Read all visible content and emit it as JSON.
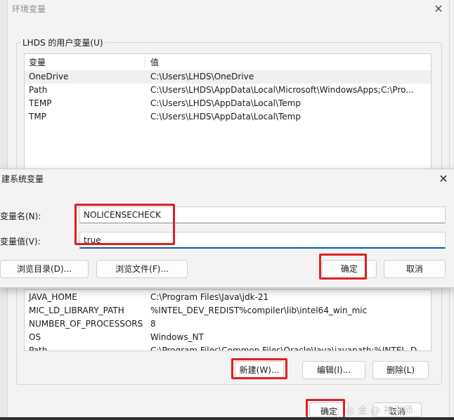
{
  "outer_dialog": {
    "title": "环境变量",
    "close_glyph": "✕",
    "user_group_label": "LHDS 的用户变量(U)",
    "user_table": {
      "headers": [
        "变量",
        "值"
      ],
      "rows": [
        [
          "OneDrive",
          "C:\\Users\\LHDS\\OneDrive"
        ],
        [
          "Path",
          "C:\\Users\\LHDS\\AppData\\Local\\Microsoft\\WindowsApps;C:\\Pro..."
        ],
        [
          "TEMP",
          "C:\\Users\\LHDS\\AppData\\Local\\Temp"
        ],
        [
          "TMP",
          "C:\\Users\\LHDS\\AppData\\Local\\Temp"
        ]
      ]
    },
    "system_table": {
      "rows": [
        [
          "JAVA_HOME",
          "C:\\Program Files\\Java\\jdk-21"
        ],
        [
          "MIC_LD_LIBRARY_PATH",
          "%INTEL_DEV_REDIST%compiler\\lib\\intel64_win_mic"
        ],
        [
          "NUMBER_OF_PROCESSORS",
          "8"
        ],
        [
          "OS",
          "Windows_NT"
        ],
        [
          "Path",
          "C:\\Program Files\\Common Files\\Oracle\\Java\\javapath;%INTEL_D..."
        ]
      ]
    },
    "buttons": {
      "new": "新建(W)...",
      "edit": "编辑(I)...",
      "delete": "删除(L)",
      "ok": "确定",
      "cancel": "取消"
    }
  },
  "inner_dialog": {
    "title": "建系统变量",
    "close_glyph": "✕",
    "name_label": "变量名(N):",
    "value_label": "变量值(V):",
    "name_value": "NOLICENSECHECK",
    "value_value": "true",
    "buttons": {
      "browse_dir": "浏览目录(D)...",
      "browse_file": "浏览文件(F)...",
      "ok": "确定",
      "cancel": "取消"
    }
  },
  "watermark": "◎ 金 @ 神马师",
  "colors": {
    "highlight_box": "#e02020",
    "focus_underline": "#005fb8",
    "dialog_bg": "#f3f3f3"
  }
}
